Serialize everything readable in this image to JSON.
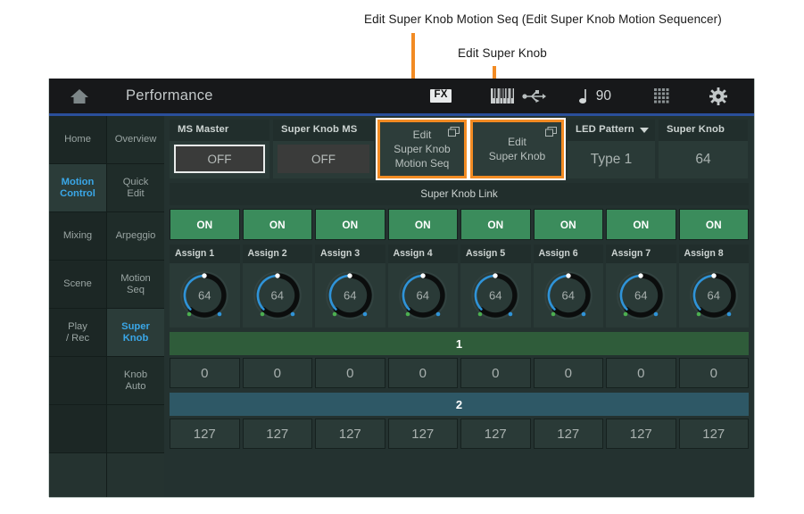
{
  "callouts": [
    {
      "id": "a",
      "text": "Edit Super Knob Motion Seq (Edit Super Knob Motion Sequencer)"
    },
    {
      "id": "b",
      "text": "Edit Super Knob"
    }
  ],
  "colors": {
    "callout_orange": "#f28b23",
    "accent_cyan": "#3aa7e8",
    "link_on_green": "#3b8c5c",
    "row1_green": "#2f5c3a",
    "row2_blue": "#2e5866",
    "screen_bg": "#243230",
    "topbar_bg": "#17181a",
    "topbar_underline": "#2a4f9b"
  },
  "topbar": {
    "home_icon": "home-icon",
    "title": "Performance",
    "fx_badge": "FX",
    "keyboard_icon": "keyboard-icon",
    "usb_icon": "usb-icon",
    "tempo_note_icon": "quarter-note-icon",
    "tempo": "90",
    "grid_icon": "grid-icon",
    "gear_icon": "gear-icon"
  },
  "sidebar": {
    "left": [
      {
        "label": "Home",
        "active": false
      },
      {
        "label": "Motion\nControl",
        "line1": "Motion",
        "line2": "Control",
        "active": true
      },
      {
        "label": "Mixing",
        "active": false
      },
      {
        "label": "Scene",
        "active": false
      },
      {
        "label": "Play\n/ Rec",
        "line1": "Play",
        "line2": "/ Rec",
        "active": false
      },
      {
        "label": "",
        "active": false
      },
      {
        "label": "",
        "active": false
      }
    ],
    "right": [
      {
        "label": "Overview",
        "active": false
      },
      {
        "label": "Quick\nEdit",
        "line1": "Quick",
        "line2": "Edit",
        "active": false
      },
      {
        "label": "Arpeggio",
        "active": false
      },
      {
        "label": "Motion\nSeq",
        "line1": "Motion",
        "line2": "Seq",
        "active": false
      },
      {
        "label": "Super\nKnob",
        "line1": "Super",
        "line2": "Knob",
        "active": true
      },
      {
        "label": "Knob\nAuto",
        "line1": "Knob",
        "line2": "Auto",
        "active": false
      },
      {
        "label": "",
        "active": false
      }
    ]
  },
  "top_row": {
    "ms_master": {
      "label": "MS Master",
      "value": "OFF",
      "selected": true
    },
    "super_knob_ms": {
      "label": "Super Knob MS",
      "value": "OFF",
      "selected": false
    },
    "edit_motion_seq": {
      "line1": "Edit",
      "line2": "Super Knob",
      "line3": "Motion Seq",
      "popup_icon": "popup-window-icon"
    },
    "edit_super_knob": {
      "line1": "Edit",
      "line2": "Super Knob",
      "popup_icon": "popup-window-icon"
    },
    "led_pattern": {
      "label": "LED Pattern",
      "value": "Type 1",
      "caret_icon": "chevron-down-icon"
    },
    "super_knob": {
      "label": "Super Knob",
      "value": "64"
    }
  },
  "super_knob_link": {
    "header": "Super Knob Link",
    "buttons": [
      "ON",
      "ON",
      "ON",
      "ON",
      "ON",
      "ON",
      "ON",
      "ON"
    ]
  },
  "assigns": [
    {
      "label": "Assign 1",
      "value": "64"
    },
    {
      "label": "Assign 2",
      "value": "64"
    },
    {
      "label": "Assign 3",
      "value": "64"
    },
    {
      "label": "Assign 4",
      "value": "64"
    },
    {
      "label": "Assign 5",
      "value": "64"
    },
    {
      "label": "Assign 6",
      "value": "64"
    },
    {
      "label": "Assign 7",
      "value": "64"
    },
    {
      "label": "Assign 8",
      "value": "64"
    }
  ],
  "value_rows": [
    {
      "header": "1",
      "style": "green",
      "values": [
        "0",
        "0",
        "0",
        "0",
        "0",
        "0",
        "0",
        "0"
      ]
    },
    {
      "header": "2",
      "style": "blue",
      "values": [
        "127",
        "127",
        "127",
        "127",
        "127",
        "127",
        "127",
        "127"
      ]
    }
  ]
}
